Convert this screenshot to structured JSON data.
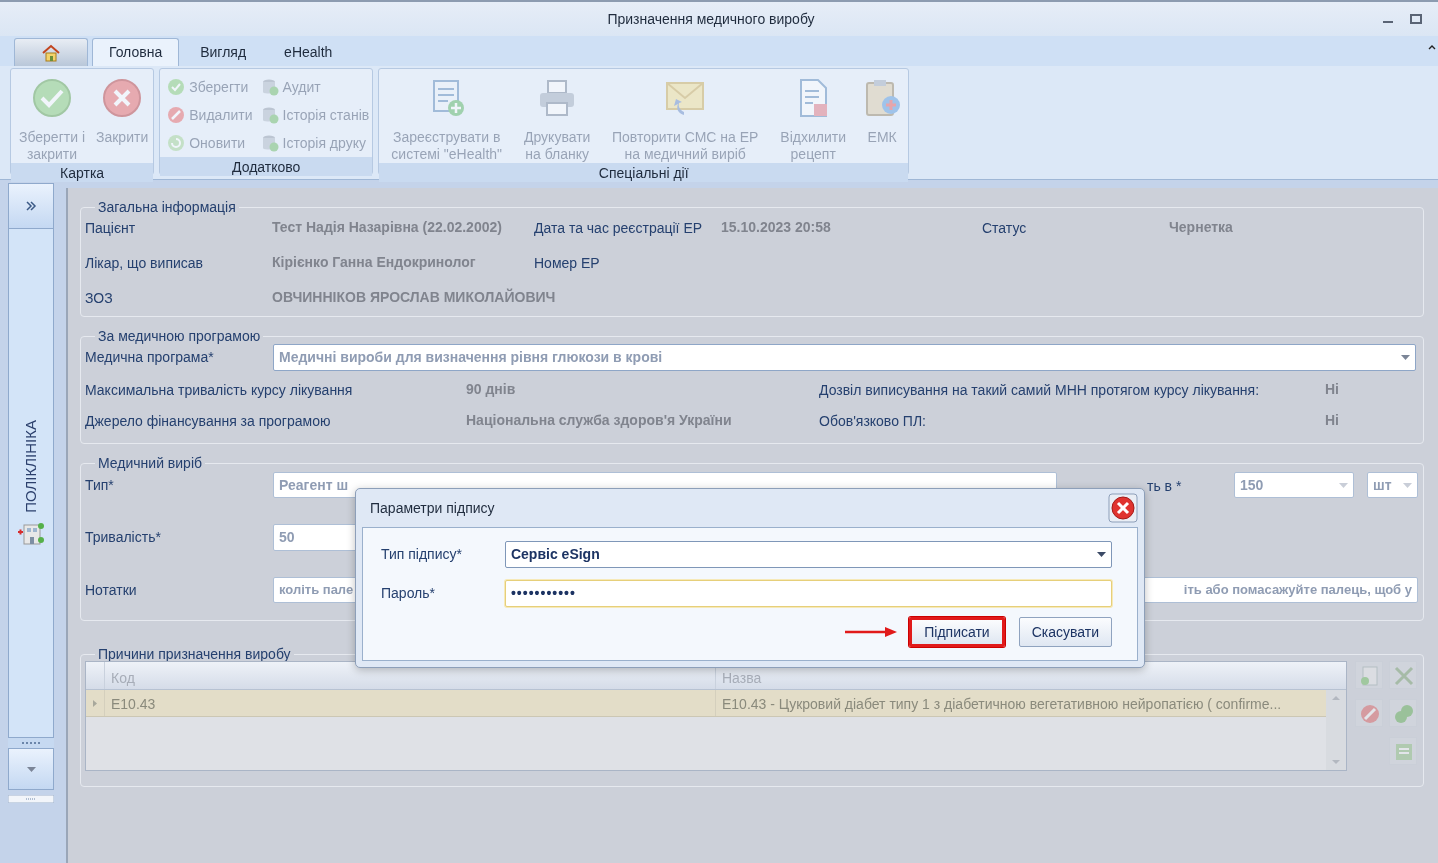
{
  "window": {
    "title": "Призначення медичного виробу"
  },
  "ribbon_tabs": [
    {
      "kind": "home",
      "selected": false
    },
    {
      "kind": "text",
      "label": "Головна",
      "selected": true
    },
    {
      "kind": "text",
      "label": "Вигляд",
      "selected": false
    },
    {
      "kind": "text",
      "label": "eHealth",
      "selected": false
    }
  ],
  "ribbon_groups": [
    {
      "title": "Картка",
      "buttons": [
        {
          "kind": "large",
          "label": "Зберегти і закрити",
          "disabled": true
        },
        {
          "kind": "large",
          "label": "Закрити",
          "disabled": true
        }
      ]
    },
    {
      "title": "Додатково",
      "buttons": [
        {
          "kind": "small",
          "label": "Зберегти",
          "disabled": true
        },
        {
          "kind": "small",
          "label": "Видалити",
          "disabled": true
        },
        {
          "kind": "small",
          "label": "Оновити",
          "disabled": true
        },
        {
          "kind": "small",
          "label": "Аудит",
          "disabled": true
        },
        {
          "kind": "small",
          "label": "Історія станів",
          "disabled": true
        },
        {
          "kind": "small",
          "label": "Історія друку",
          "disabled": true
        }
      ]
    },
    {
      "title": "Спеціальні дії",
      "buttons": [
        {
          "kind": "large",
          "label": "Зареєструвати в системі \"eHealth\"",
          "disabled": true
        },
        {
          "kind": "large",
          "label": "Друкувати на бланку",
          "disabled": true
        },
        {
          "kind": "large",
          "label": "Повторити СМС на ЕР на медичний виріб",
          "disabled": true
        },
        {
          "kind": "large",
          "label": "Відхилити рецепт",
          "disabled": true
        },
        {
          "kind": "large",
          "label": "ЕМК",
          "disabled": true
        }
      ]
    }
  ],
  "sidebar": {
    "label": "ПОЛІКЛІНІКА"
  },
  "general_info": {
    "title": "Загальна інформація",
    "rows": [
      [
        {
          "label": "Пацієнт",
          "value": "Тест Надія Назарівна (22.02.2002)"
        },
        {
          "label": "Дата та час реєстрації ЕР",
          "value": "15.10.2023 20:58"
        },
        {
          "label": "Статус",
          "value": "Чернетка"
        }
      ],
      [
        {
          "label": "Лікар, що виписав",
          "value": "Кірієнко Ганна Ендокринолог"
        },
        {
          "label": "Номер ЕР"
        }
      ],
      [
        {
          "label": "ЗОЗ",
          "value": "ОВЧИННІКОВ ЯРОСЛАВ МИКОЛАЙОВИЧ"
        }
      ]
    ]
  },
  "program": {
    "title": "За медичною програмою",
    "program_label": "Медична програма*",
    "program_value": "Медичні вироби для визначення рівня глюкози в крові",
    "rows": [
      [
        {
          "label": "Максимальна тривалість курсу лікування",
          "value": "90 днів"
        },
        {
          "label": "Дозвіл виписування на такий самий МНН протягом курсу лікування:",
          "value": "Ні"
        }
      ],
      [
        {
          "label": "Джерело фінансування за програмою",
          "value": "Національна служба здоров'я України"
        },
        {
          "label": "Обов'язково ПЛ:",
          "value": "Ні"
        }
      ]
    ]
  },
  "device": {
    "title": "Медичний виріб",
    "type_label": "Тип*",
    "type_value": "Реагент ш",
    "quantity_label": "ть в *",
    "quantity_value": "150",
    "unit_value": "шт",
    "duration_label": "Тривалість*",
    "duration_value": "50",
    "notes_label": "Нотатки",
    "notes_visible_start": "коліть пале",
    "notes_visible_end": "іть або помасажуйте палець, щоб у"
  },
  "reasons": {
    "title": "Причини призначення виробу",
    "columns": [
      "Код",
      "Назва"
    ],
    "rows": [
      {
        "selected": true,
        "cells": [
          "E10.43",
          "E10.43 - Цукровий діабет типу 1 з діабетичною вегетативною нейропатією ( confirme..."
        ]
      }
    ],
    "tools": [
      {
        "disabled": true
      },
      {
        "disabled": true
      },
      {
        "disabled": true
      },
      {
        "disabled": true
      },
      {
        "disabled": true
      }
    ]
  },
  "dialog": {
    "title": "Параметри підпису",
    "sign_type_label": "Тип підпису*",
    "sign_type_value": "Сервіс eSign",
    "password_label": "Пароль*",
    "password_value": "•••••••••••",
    "buttons": [
      {
        "label": "Підписати",
        "highlighted": true
      },
      {
        "label": "Скасувати",
        "highlighted": false
      }
    ]
  }
}
